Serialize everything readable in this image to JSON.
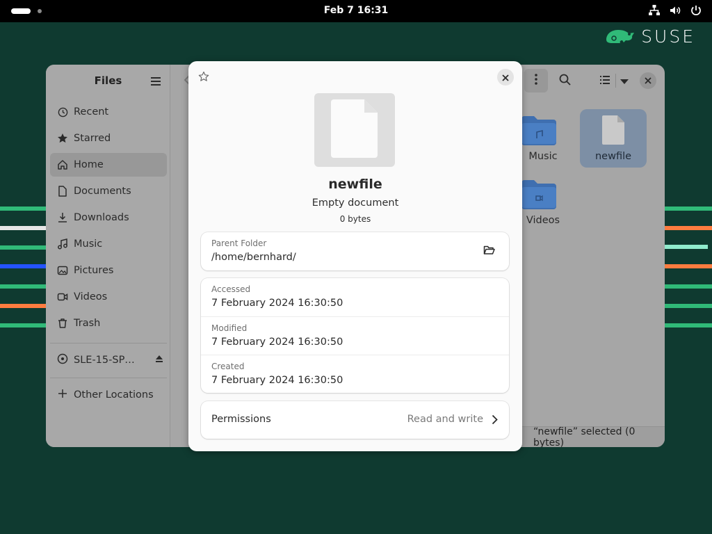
{
  "topbar": {
    "clock": "Feb 7  16:31",
    "tray_icons": [
      "network-icon",
      "volume-icon",
      "power-icon"
    ]
  },
  "brand": {
    "name": "SUSE",
    "logo_icon": "chameleon-logo",
    "color": "#30ba78"
  },
  "files_window": {
    "title": "Files",
    "sidebar": {
      "items": [
        {
          "label": "Recent",
          "icon": "clock-icon"
        },
        {
          "label": "Starred",
          "icon": "star-icon"
        },
        {
          "label": "Home",
          "icon": "home-icon",
          "active": true
        },
        {
          "label": "Documents",
          "icon": "document-icon"
        },
        {
          "label": "Downloads",
          "icon": "download-icon"
        },
        {
          "label": "Music",
          "icon": "music-icon"
        },
        {
          "label": "Pictures",
          "icon": "picture-icon"
        },
        {
          "label": "Videos",
          "icon": "video-icon"
        },
        {
          "label": "Trash",
          "icon": "trash-icon"
        }
      ],
      "drive": {
        "label": "SLE-15-SP…",
        "icon": "disc-icon",
        "action_icon": "eject-icon"
      },
      "other": {
        "label": "Other Locations",
        "icon": "plus-icon"
      }
    },
    "content": {
      "tiles": [
        {
          "label": "Music",
          "icon": "folder-music-icon"
        },
        {
          "label": "newfile",
          "icon": "file-icon",
          "selected": true
        },
        {
          "label": "Videos",
          "icon": "folder-video-icon"
        }
      ],
      "status": "“newfile” selected  (0 bytes)"
    }
  },
  "properties": {
    "name": "newfile",
    "type": "Empty document",
    "size": "0 bytes",
    "parent_folder": {
      "label": "Parent Folder",
      "value": "/home/bernhard/"
    },
    "times": [
      {
        "label": "Accessed",
        "value": "7 February 2024 16:30:50"
      },
      {
        "label": "Modified",
        "value": "7 February 2024 16:30:50"
      },
      {
        "label": "Created",
        "value": "7 February 2024 16:30:50"
      }
    ],
    "permissions": {
      "label": "Permissions",
      "value": "Read and write"
    }
  },
  "colors": {
    "wallpaper": "#0f3a30",
    "stripe_green": "#30ba78",
    "stripe_orange": "#fe7c3f",
    "stripe_blue": "#2453ff",
    "stripe_mint": "#90ebcd",
    "folder_blue": "#3f6fb0"
  }
}
